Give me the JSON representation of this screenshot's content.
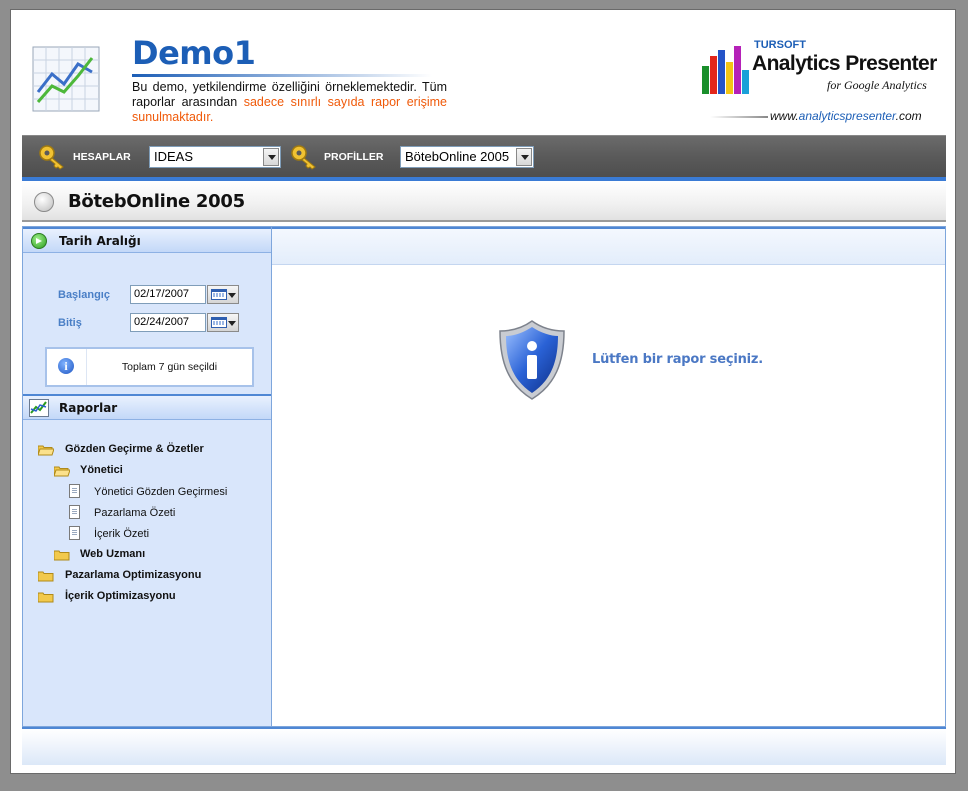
{
  "header": {
    "title": "Demo1",
    "desc_part1": "Bu demo, yetkilendirme özelliğini örneklemektedir. Tüm raporlar arasından",
    "desc_highlight": "sadece sınırlı sayıda rapor erişime sunulmaktadır.",
    "brand_company": "TURSOFT",
    "brand_product": "Analytics Presenter",
    "brand_tagline": "for Google Analytics",
    "brand_url_prefix": "www.",
    "brand_url_name": "analyticspresenter",
    "brand_url_suffix": ".com"
  },
  "toolbar": {
    "accounts_label": "HESAPLAR",
    "accounts_value": "IDEAS",
    "profiles_label": "PROFİLLER",
    "profiles_value": "BötebOnline 2005"
  },
  "profile": {
    "title": "BötebOnline 2005"
  },
  "date_range": {
    "heading": "Tarih Aralığı",
    "start_label": "Başlangıç",
    "start_value": "02/17/2007",
    "end_label": "Bitiş",
    "end_value": "02/24/2007",
    "summary": "Toplam 7 gün seçildi"
  },
  "reports": {
    "heading": "Raporlar",
    "tree": {
      "group1": "Gözden Geçirme & Özetler",
      "sub1": "Yönetici",
      "item1": "Yönetici Gözden Geçirmesi",
      "item2": "Pazarlama Özeti",
      "item3": "İçerik Özeti",
      "sub2": "Web Uzmanı",
      "group2": "Pazarlama Optimizasyonu",
      "group3": "İçerik Optimizasyonu"
    }
  },
  "main": {
    "message": "Lütfen bir rapor seçiniz."
  },
  "colors": {
    "accent_blue": "#1c5eb6",
    "highlight_orange": "#f05a0a",
    "toolbar_gray": "#5a5a5a",
    "sidebar_bg": "#d9e6fb"
  },
  "icons": {
    "logo": "line-chart-icon",
    "accounts": "key-icon",
    "profiles": "key-icon",
    "profile": "pointer-icon",
    "date_range": "green-arrow-icon",
    "reports": "chart-icon",
    "summary": "info-icon",
    "main": "info-shield-icon"
  }
}
